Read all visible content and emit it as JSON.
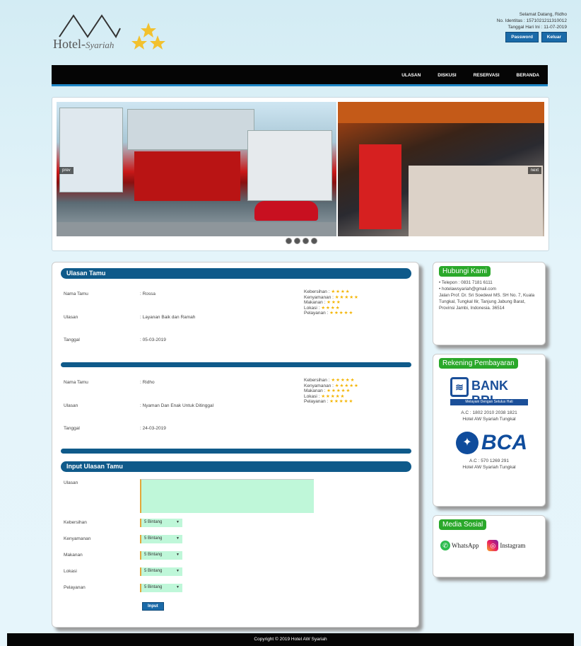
{
  "header": {
    "logo_text": "Hotel-",
    "logo_sub": "Syariah",
    "greeting": "Selamat Datang, Ridho",
    "id_line": "No. Identitas : 1571021211310012",
    "date_line": "Tanggal Hari Ini : 11-07-2019",
    "btn_password": "Password",
    "btn_logout": "Keluar"
  },
  "nav": {
    "items": [
      "ULASAN",
      "DISKUSI",
      "RESERVASI",
      "BERANDA"
    ]
  },
  "slider": {
    "prev_label": "prev",
    "next_label": "next",
    "dot_count": 4
  },
  "reviews": {
    "title": "Ulasan Tamu",
    "field_name": "Nama Tamu",
    "field_review": "Ulasan",
    "field_date": "Tanggal",
    "items": [
      {
        "name": ": Rossa",
        "review": ": Layanan Baik dan Ramah",
        "date": ": 05-03-2019",
        "ratings": [
          {
            "label": "Kebersihan :",
            "stars": "★★★★"
          },
          {
            "label": "Kenyamanan :",
            "stars": "★★★★★"
          },
          {
            "label": "Makanan :",
            "stars": "★★★"
          },
          {
            "label": "Lokasi :",
            "stars": "★★★★"
          },
          {
            "label": "Pelayanan :",
            "stars": "★★★★★"
          }
        ]
      },
      {
        "name": ": Ridho",
        "review": ": Nyaman Dan Enak Untuk Ditinggal",
        "date": ": 24-03-2019",
        "ratings": [
          {
            "label": "Kebersihan :",
            "stars": "★★★★★"
          },
          {
            "label": "Kenyamanan :",
            "stars": "★★★★★"
          },
          {
            "label": "Makanan :",
            "stars": "★★★★★"
          },
          {
            "label": "Lokasi :",
            "stars": "★★★★★"
          },
          {
            "label": "Pelayanan :",
            "stars": "★★★★★"
          }
        ]
      }
    ]
  },
  "input": {
    "title": "Input Ulasan Tamu",
    "review_label": "Ulasan",
    "fields": [
      {
        "label": "Kebersihan",
        "value": "5 Bintang"
      },
      {
        "label": "Kenyamanan",
        "value": "5 Bintang"
      },
      {
        "label": "Makanan",
        "value": "5 Bintang"
      },
      {
        "label": "Lokasi",
        "value": "5 Bintang"
      },
      {
        "label": "Pelayanan",
        "value": "5 Bintang"
      }
    ],
    "submit": "Input"
  },
  "contact": {
    "title": "Hubungi Kami",
    "phone": "• Telepon : 0831 7181 6111",
    "email": "• hotelawsyariah@gmail.com",
    "address": "Jalan Prof. Dr. Sri Soedewi MS. SH No. 7, Kuala Tungkal, Tungkal Ilir, Tanjung Jabung Barat, Provinsi Jambi, Indonesia. 36514"
  },
  "payment": {
    "title": "Rekening Pembayaran",
    "bri_name": "BANK BRI",
    "bri_tag": "Melayani Dengan Setulus Hati",
    "bri_ac": "A.C : 1802 2010 2038 1821",
    "bri_holder": "Hotel AW Syariah Tungkal",
    "bca_name": "BCA",
    "bca_ac": "A.C : 570 1269 291",
    "bca_holder": "Hotel AW Syariah Tungkal"
  },
  "social": {
    "title": "Media Sosial",
    "whatsapp": "WhatsApp",
    "instagram": "Instagram"
  },
  "footer": {
    "copyright": "Copyright © 2019 Hotel AW Syariah"
  },
  "colors": {
    "accent": "#0f5a8a",
    "green": "#2aa82a",
    "field_bg": "#bff7d9"
  }
}
